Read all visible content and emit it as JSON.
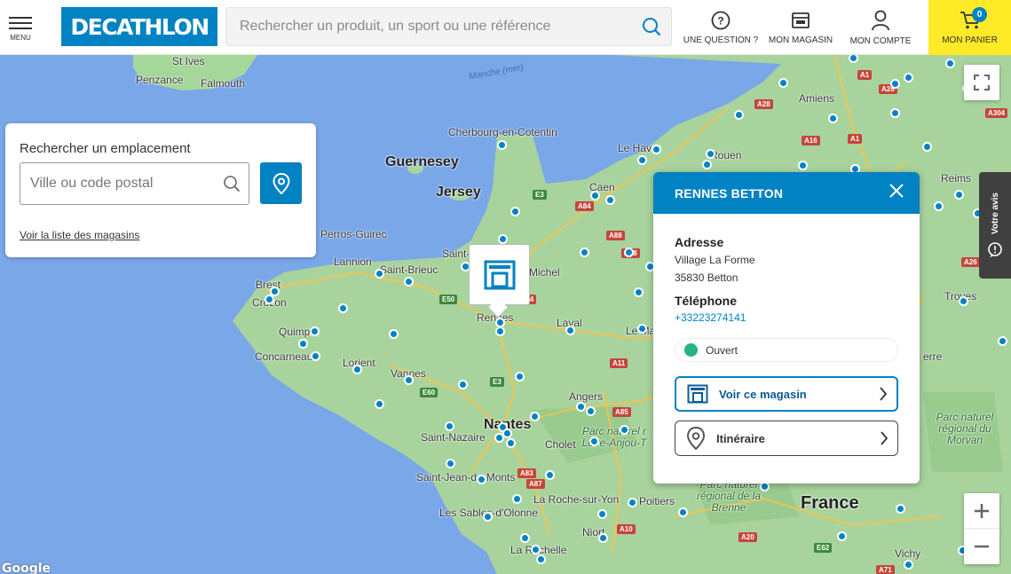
{
  "header": {
    "menu_label": "MENU",
    "logo_text": "DECATHLON",
    "search_placeholder": "Rechercher un produit, un sport ou une référence",
    "question_label": "UNE QUESTION ?",
    "store_label": "MON MAGASIN",
    "account_label": "MON COMPTE",
    "cart_label": "MON PANIER",
    "cart_count": "0"
  },
  "location_panel": {
    "title": "Rechercher un emplacement",
    "input_placeholder": "Ville ou code postal",
    "list_link": "Voir la liste des magasins"
  },
  "popup": {
    "store_name": "RENNES BETTON",
    "address_label": "Adresse",
    "address_line1": "Village La Forme",
    "address_line2": "35830 Betton",
    "phone_label": "Téléphone",
    "phone": "+33223274141",
    "status": "Ouvert",
    "view_store_label": "Voir ce magasin",
    "directions_label": "Itinéraire"
  },
  "review_tab": "Votre avis",
  "map": {
    "places": [
      {
        "name": "St Ives",
        "cls": ""
      },
      {
        "name": "Penzance",
        "cls": ""
      },
      {
        "name": "Falmouth",
        "cls": ""
      },
      {
        "name": "Manche (mer)",
        "cls": "sea"
      },
      {
        "name": "Cherbourg-en-Cotentin",
        "cls": ""
      },
      {
        "name": "Guernesey",
        "cls": "big"
      },
      {
        "name": "Jersey",
        "cls": "big"
      },
      {
        "name": "Le Havre",
        "cls": ""
      },
      {
        "name": "Rouen",
        "cls": ""
      },
      {
        "name": "Amiens",
        "cls": ""
      },
      {
        "name": "Reims",
        "cls": ""
      },
      {
        "name": "Caen",
        "cls": ""
      },
      {
        "name": "Perros-Guirec",
        "cls": ""
      },
      {
        "name": "Lannion",
        "cls": ""
      },
      {
        "name": "Saint-Brieuc",
        "cls": ""
      },
      {
        "name": "Saint-",
        "cls": ""
      },
      {
        "name": "Michel",
        "cls": ""
      },
      {
        "name": "Brest",
        "cls": ""
      },
      {
        "name": "Crozon",
        "cls": ""
      },
      {
        "name": "Quimper",
        "cls": ""
      },
      {
        "name": "Concarneau",
        "cls": ""
      },
      {
        "name": "Lorient",
        "cls": ""
      },
      {
        "name": "Vannes",
        "cls": ""
      },
      {
        "name": "Rennes",
        "cls": ""
      },
      {
        "name": "Laval",
        "cls": ""
      },
      {
        "name": "Le Ma",
        "cls": ""
      },
      {
        "name": "Angers",
        "cls": ""
      },
      {
        "name": "Nantes",
        "cls": "big"
      },
      {
        "name": "Saint-Nazaire",
        "cls": ""
      },
      {
        "name": "Cholet",
        "cls": ""
      },
      {
        "name": "Saint-Jean-de-Monts",
        "cls": ""
      },
      {
        "name": "La Roche-sur-Yon",
        "cls": ""
      },
      {
        "name": "Les Sables-d'Olonne",
        "cls": ""
      },
      {
        "name": "Poitiers",
        "cls": ""
      },
      {
        "name": "Niort",
        "cls": ""
      },
      {
        "name": "La Rochelle",
        "cls": ""
      },
      {
        "name": "France",
        "cls": "country"
      },
      {
        "name": "Troyes",
        "cls": ""
      },
      {
        "name": "erre",
        "cls": ""
      },
      {
        "name": "Vichy",
        "cls": ""
      }
    ],
    "parks": [
      "Parc naturel r Loire-Anjou-T",
      "Parc naturel régional de la Brenne",
      "Parc naturel régional du Morvan"
    ],
    "roads": [
      "A1",
      "A26",
      "A28",
      "A16",
      "A1",
      "A304",
      "E3",
      "A84",
      "A88",
      "A28",
      "E50",
      "A11",
      "E60",
      "E3",
      "A85",
      "A83",
      "A87",
      "A10",
      "A20",
      "E62",
      "A71",
      "A26",
      "A4"
    ],
    "google": "Google"
  }
}
